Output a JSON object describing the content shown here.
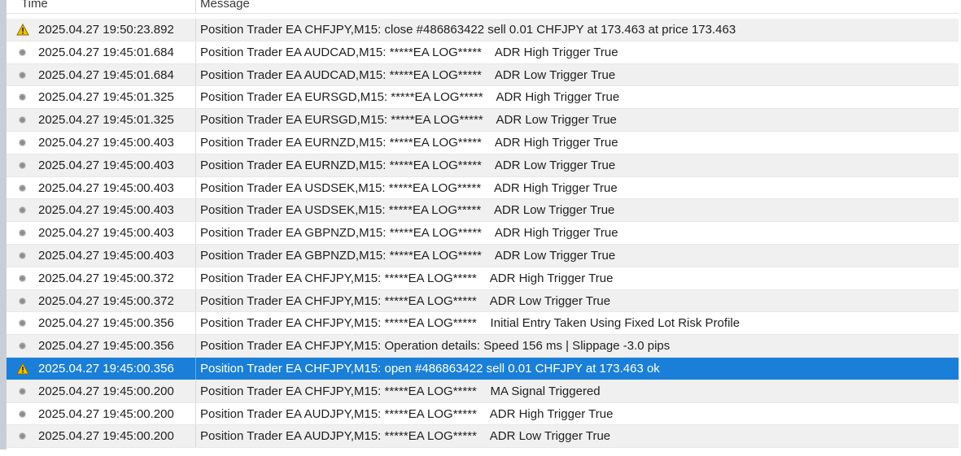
{
  "header": {
    "time_label": "Time",
    "message_label": "Message"
  },
  "rows": [
    {
      "icon": "warning-icon",
      "time": "2025.04.27 19:50:23.892",
      "message": "Position Trader EA CHFJPY,M15: close #486863422 sell 0.01 CHFJPY at 173.463 at price 173.463"
    },
    {
      "icon": "info-dot-icon",
      "time": "2025.04.27 19:45:01.684",
      "message": "Position Trader EA AUDCAD,M15: *****EA LOG*****    ADR High Trigger True"
    },
    {
      "icon": "info-dot-icon",
      "time": "2025.04.27 19:45:01.684",
      "message": "Position Trader EA AUDCAD,M15: *****EA LOG*****    ADR Low Trigger True"
    },
    {
      "icon": "info-dot-icon",
      "time": "2025.04.27 19:45:01.325",
      "message": "Position Trader EA EURSGD,M15: *****EA LOG*****    ADR High Trigger True"
    },
    {
      "icon": "info-dot-icon",
      "time": "2025.04.27 19:45:01.325",
      "message": "Position Trader EA EURSGD,M15: *****EA LOG*****    ADR Low Trigger True"
    },
    {
      "icon": "info-dot-icon",
      "time": "2025.04.27 19:45:00.403",
      "message": "Position Trader EA EURNZD,M15: *****EA LOG*****    ADR High Trigger True"
    },
    {
      "icon": "info-dot-icon",
      "time": "2025.04.27 19:45:00.403",
      "message": "Position Trader EA EURNZD,M15: *****EA LOG*****    ADR Low Trigger True"
    },
    {
      "icon": "info-dot-icon",
      "time": "2025.04.27 19:45:00.403",
      "message": "Position Trader EA USDSEK,M15: *****EA LOG*****    ADR High Trigger True"
    },
    {
      "icon": "info-dot-icon",
      "time": "2025.04.27 19:45:00.403",
      "message": "Position Trader EA USDSEK,M15: *****EA LOG*****    ADR Low Trigger True"
    },
    {
      "icon": "info-dot-icon",
      "time": "2025.04.27 19:45:00.403",
      "message": "Position Trader EA GBPNZD,M15: *****EA LOG*****    ADR High Trigger True"
    },
    {
      "icon": "info-dot-icon",
      "time": "2025.04.27 19:45:00.403",
      "message": "Position Trader EA GBPNZD,M15: *****EA LOG*****    ADR Low Trigger True"
    },
    {
      "icon": "info-dot-icon",
      "time": "2025.04.27 19:45:00.372",
      "message": "Position Trader EA CHFJPY,M15: *****EA LOG*****    ADR High Trigger True"
    },
    {
      "icon": "info-dot-icon",
      "time": "2025.04.27 19:45:00.372",
      "message": "Position Trader EA CHFJPY,M15: *****EA LOG*****    ADR Low Trigger True"
    },
    {
      "icon": "info-dot-icon",
      "time": "2025.04.27 19:45:00.356",
      "message": "Position Trader EA CHFJPY,M15: *****EA LOG*****    Initial Entry Taken Using Fixed Lot Risk Profile"
    },
    {
      "icon": "info-dot-icon",
      "time": "2025.04.27 19:45:00.356",
      "message": "Position Trader EA CHFJPY,M15: Operation details: Speed 156 ms | Slippage -3.0 pips"
    },
    {
      "icon": "warning-icon",
      "time": "2025.04.27 19:45:00.356",
      "message": "Position Trader EA CHFJPY,M15: open #486863422 sell 0.01 CHFJPY at 173.463 ok",
      "selected": true
    },
    {
      "icon": "info-dot-icon",
      "time": "2025.04.27 19:45:00.200",
      "message": "Position Trader EA CHFJPY,M15: *****EA LOG*****    MA Signal Triggered"
    },
    {
      "icon": "info-dot-icon",
      "time": "2025.04.27 19:45:00.200",
      "message": "Position Trader EA AUDJPY,M15: *****EA LOG*****    ADR High Trigger True"
    },
    {
      "icon": "info-dot-icon",
      "time": "2025.04.27 19:45:00.200",
      "message": "Position Trader EA AUDJPY,M15: *****EA LOG*****    ADR Low Trigger True"
    }
  ],
  "colors": {
    "selected_row": "#1a7fd8",
    "warning": "#f2c200"
  }
}
